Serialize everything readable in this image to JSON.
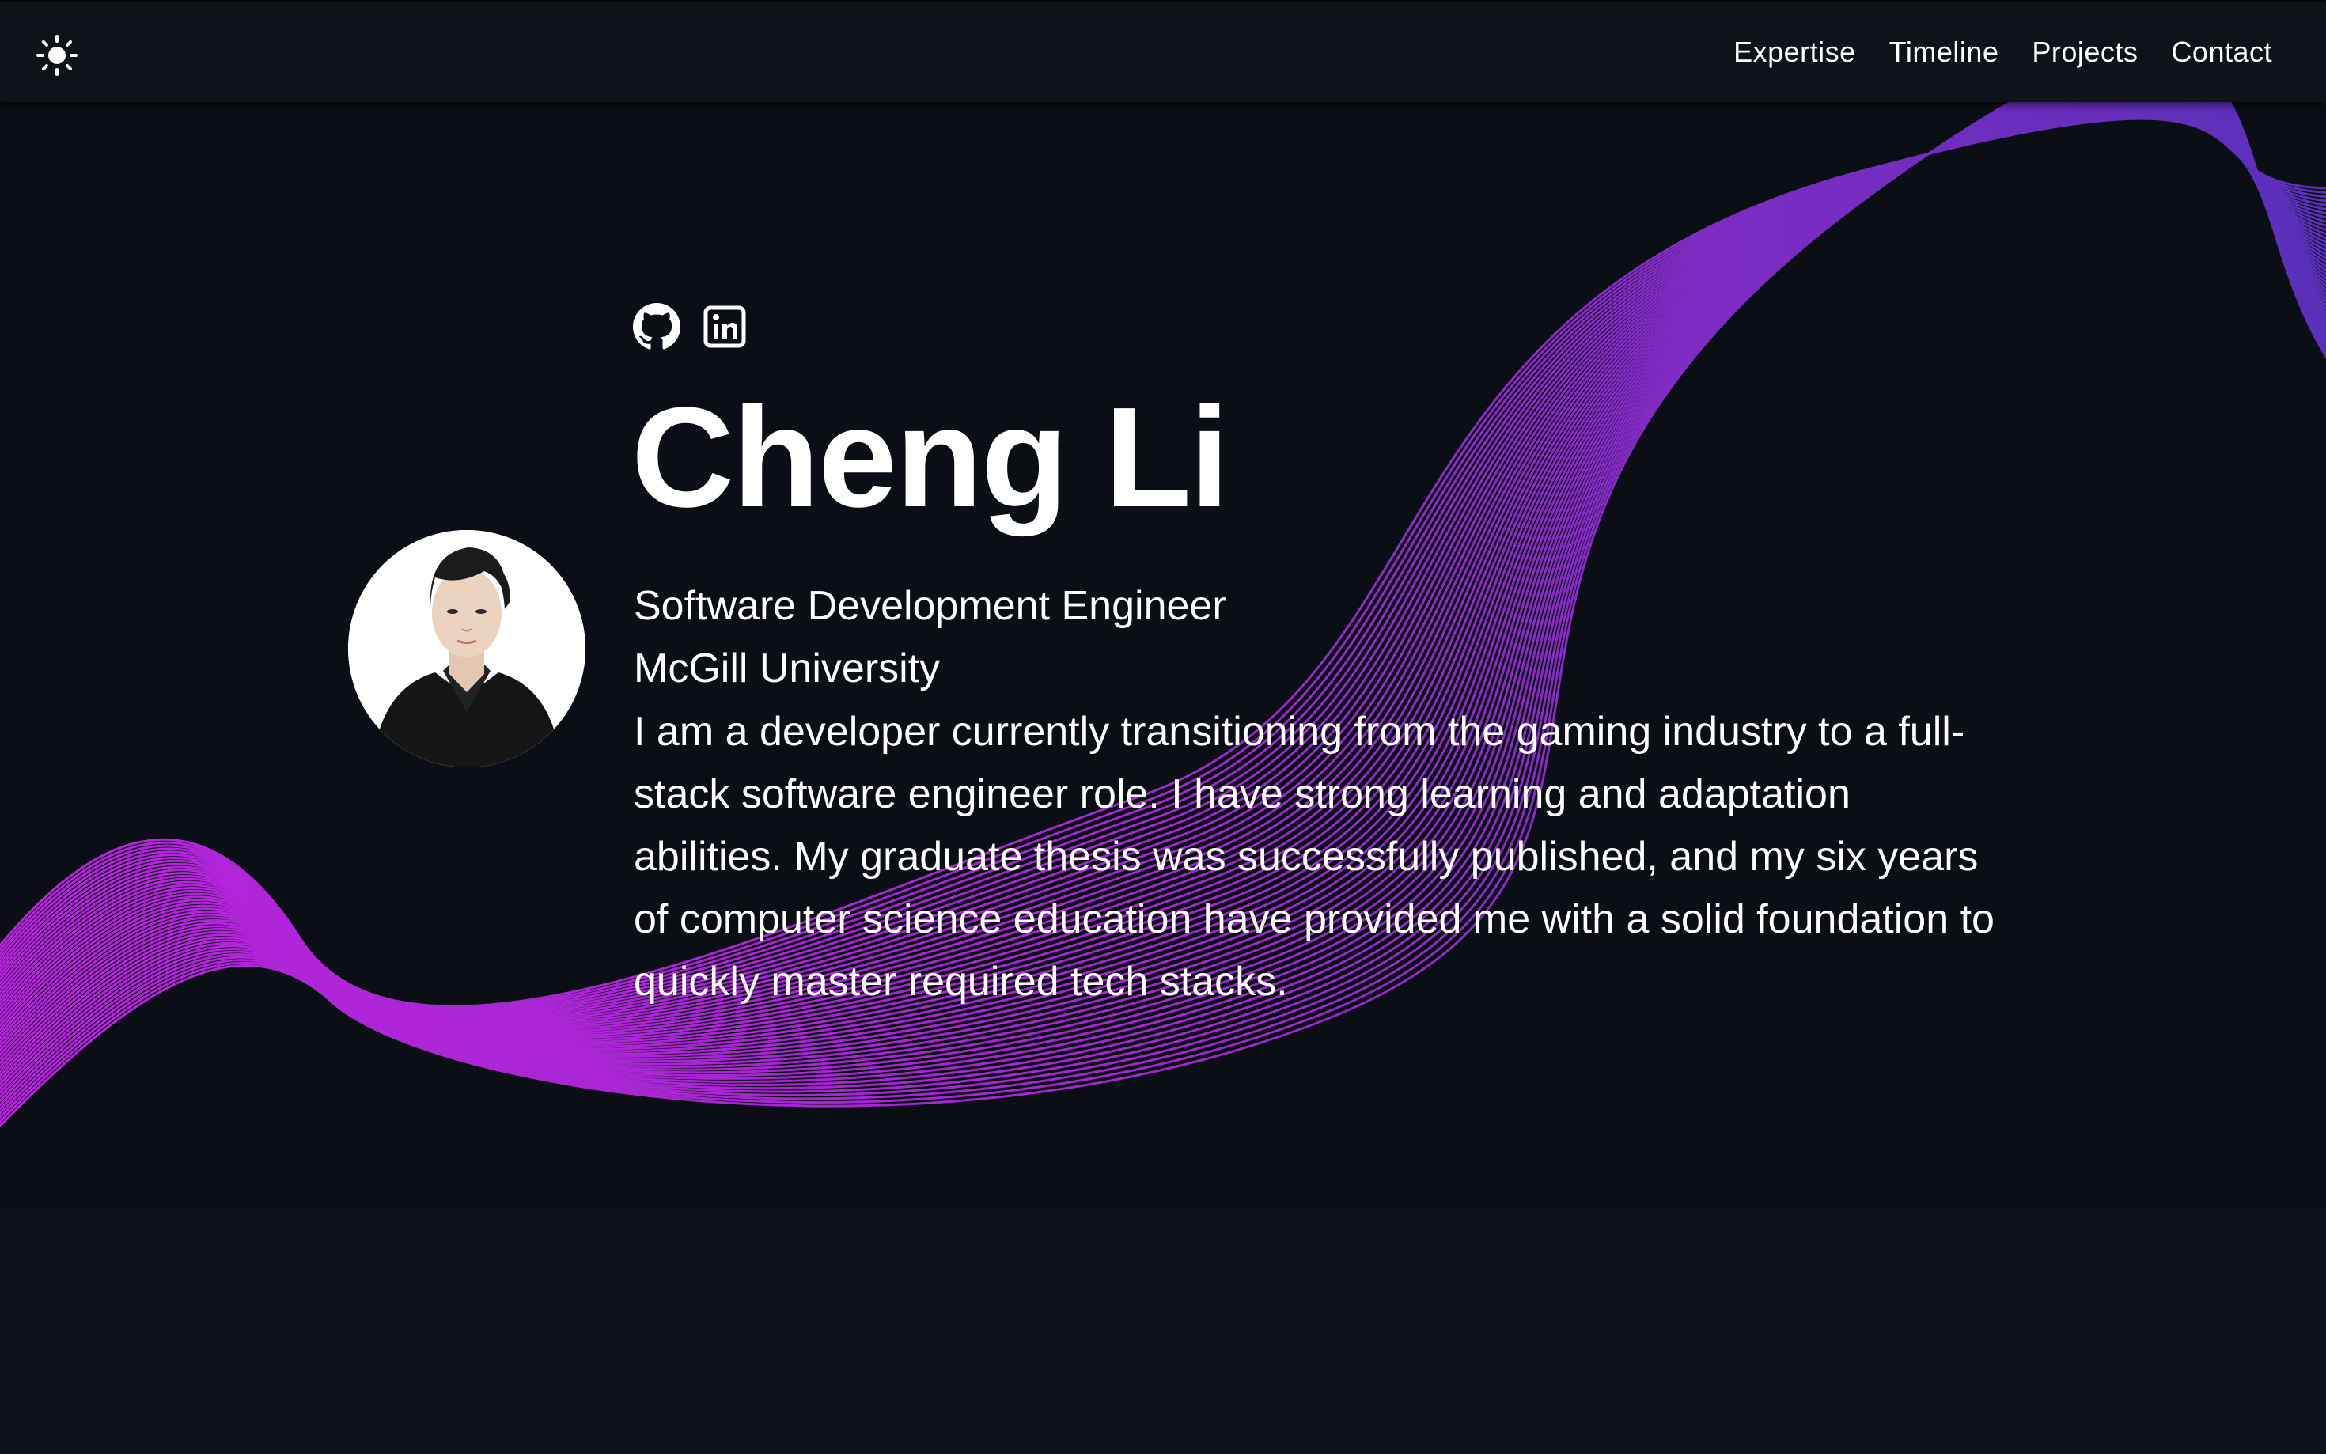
{
  "nav": {
    "theme_toggle_icon": "sun-icon",
    "links": [
      {
        "label": "Expertise"
      },
      {
        "label": "Timeline"
      },
      {
        "label": "Projects"
      },
      {
        "label": "Contact"
      }
    ]
  },
  "hero": {
    "social": [
      {
        "icon": "github-icon"
      },
      {
        "icon": "linkedin-icon"
      }
    ],
    "avatar_icon": "profile-photo",
    "name": "Cheng Li",
    "role": "Software Development Engineer",
    "school": "McGill University",
    "bio": "I am a developer currently transitioning from the gaming industry to a full-stack software engineer role. I have strong learning and adaptation abilities. My graduate thesis was successfully published, and my six years of computer science education have provided me with a solid foundation to quickly master required tech stacks."
  },
  "colors": {
    "background": "#0b0e14",
    "navbar": "#0f1319",
    "wave_start": "#c026e8",
    "wave_end": "#5b32c2",
    "text": "#ffffff"
  }
}
